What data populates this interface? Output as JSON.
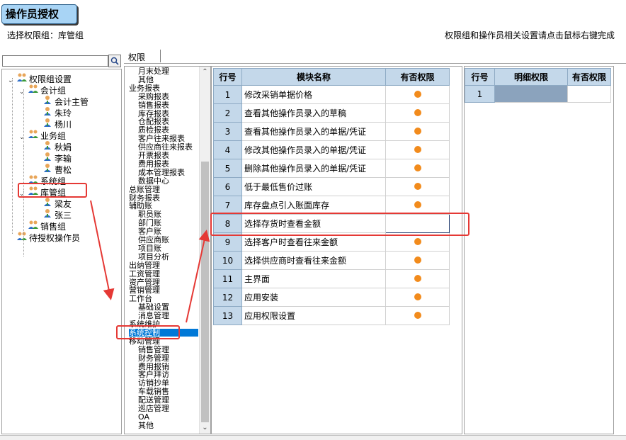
{
  "app": {
    "title": "操作员授权"
  },
  "header": {
    "group_label": "选择权限组：库管组",
    "hint": "权限组和操作员相关设置请点击鼠标右键完成"
  },
  "search": {
    "value": ""
  },
  "tree": [
    {
      "label": "权限组设置",
      "level": 0,
      "toggle": "expanded"
    },
    {
      "label": "会计组",
      "level": 1,
      "toggle": "expanded"
    },
    {
      "label": "会计主管",
      "level": 2
    },
    {
      "label": "朱玲",
      "level": 2
    },
    {
      "label": "杨川",
      "level": 2
    },
    {
      "label": "业务组",
      "level": 1,
      "toggle": "expanded"
    },
    {
      "label": "秋娟",
      "level": 2
    },
    {
      "label": "李输",
      "level": 2
    },
    {
      "label": "曹松",
      "level": 2
    },
    {
      "label": "系统组",
      "level": 1
    },
    {
      "label": "库管组",
      "level": 1,
      "toggle": "expanded",
      "highlighted": true
    },
    {
      "label": "梁友",
      "level": 2
    },
    {
      "label": "张三",
      "level": 2
    },
    {
      "label": "销售组",
      "level": 1
    },
    {
      "label": "待授权操作员",
      "level": 0
    }
  ],
  "tab": {
    "label": "权限"
  },
  "modules": [
    {
      "label": "月末处理",
      "indent": 1
    },
    {
      "label": "其他",
      "indent": 1
    },
    {
      "label": "业务报表",
      "indent": 0
    },
    {
      "label": "采购报表",
      "indent": 1
    },
    {
      "label": "销售报表",
      "indent": 1
    },
    {
      "label": "库存报表",
      "indent": 1
    },
    {
      "label": "仓配报表",
      "indent": 1
    },
    {
      "label": "质检报表",
      "indent": 1
    },
    {
      "label": "客户往来报表",
      "indent": 1
    },
    {
      "label": "供应商往来报表",
      "indent": 1
    },
    {
      "label": "开票报表",
      "indent": 1
    },
    {
      "label": "费用报表",
      "indent": 1
    },
    {
      "label": "成本管理报表",
      "indent": 1
    },
    {
      "label": "数据中心",
      "indent": 1
    },
    {
      "label": "总账管理",
      "indent": 0
    },
    {
      "label": "财务报表",
      "indent": 0
    },
    {
      "label": "辅助账",
      "indent": 0
    },
    {
      "label": "职员账",
      "indent": 1
    },
    {
      "label": "部门账",
      "indent": 1
    },
    {
      "label": "客户账",
      "indent": 1
    },
    {
      "label": "供应商账",
      "indent": 1
    },
    {
      "label": "项目账",
      "indent": 1
    },
    {
      "label": "项目分析",
      "indent": 1
    },
    {
      "label": "出纳管理",
      "indent": 0
    },
    {
      "label": "工资管理",
      "indent": 0
    },
    {
      "label": "资产管理",
      "indent": 0
    },
    {
      "label": "营销管理",
      "indent": 0
    },
    {
      "label": "工作台",
      "indent": 0
    },
    {
      "label": "基础设置",
      "indent": 1
    },
    {
      "label": "消息管理",
      "indent": 1
    },
    {
      "label": "系统维护",
      "indent": 0
    },
    {
      "label": "系统控制",
      "indent": 0,
      "selected": true
    },
    {
      "label": "移动管理",
      "indent": 0
    },
    {
      "label": "销售管理",
      "indent": 1
    },
    {
      "label": "财务管理",
      "indent": 1
    },
    {
      "label": "费用报销",
      "indent": 1
    },
    {
      "label": "客户拜访",
      "indent": 1
    },
    {
      "label": "访销抄单",
      "indent": 1
    },
    {
      "label": "车载销售",
      "indent": 1
    },
    {
      "label": "配送管理",
      "indent": 1
    },
    {
      "label": "巡店管理",
      "indent": 1
    },
    {
      "label": "OA",
      "indent": 1
    },
    {
      "label": "其他",
      "indent": 1
    }
  ],
  "grid": {
    "headers": [
      "行号",
      "模块名称",
      "有否权限"
    ],
    "rows": [
      {
        "no": "1",
        "name": "修改采销单据价格",
        "perm": true
      },
      {
        "no": "2",
        "name": "查看其他操作员录入的草稿",
        "perm": true
      },
      {
        "no": "3",
        "name": "查看其他操作员录入的单据/凭证",
        "perm": true
      },
      {
        "no": "4",
        "name": "修改其他操作员录入的单据/凭证",
        "perm": true
      },
      {
        "no": "5",
        "name": "删除其他操作员录入的单据/凭证",
        "perm": true
      },
      {
        "no": "6",
        "name": "低于最低售价过账",
        "perm": true
      },
      {
        "no": "7",
        "name": "库存盘点引入账面库存",
        "perm": true
      },
      {
        "no": "8",
        "name": "选择存货时查看金额",
        "perm": false,
        "editing": true
      },
      {
        "no": "9",
        "name": "选择客户时查看往来金额",
        "perm": true
      },
      {
        "no": "10",
        "name": "选择供应商时查看往来金额",
        "perm": true
      },
      {
        "no": "11",
        "name": "主界面",
        "perm": true
      },
      {
        "no": "12",
        "name": "应用安装",
        "perm": true
      },
      {
        "no": "13",
        "name": "应用权限设置",
        "perm": true
      }
    ]
  },
  "detail": {
    "headers": [
      "行号",
      "明细权限",
      "有否权限"
    ],
    "rows": [
      {
        "no": "1"
      }
    ]
  },
  "colors": {
    "permission_dot": "#f28b1c",
    "annotation": "#e53935",
    "header_bg": "#c4d8ea",
    "selection": "#0078d7"
  },
  "icons": {
    "tree_group": "users-group-icon",
    "tree_user": "user-icon",
    "search": "search-icon"
  }
}
